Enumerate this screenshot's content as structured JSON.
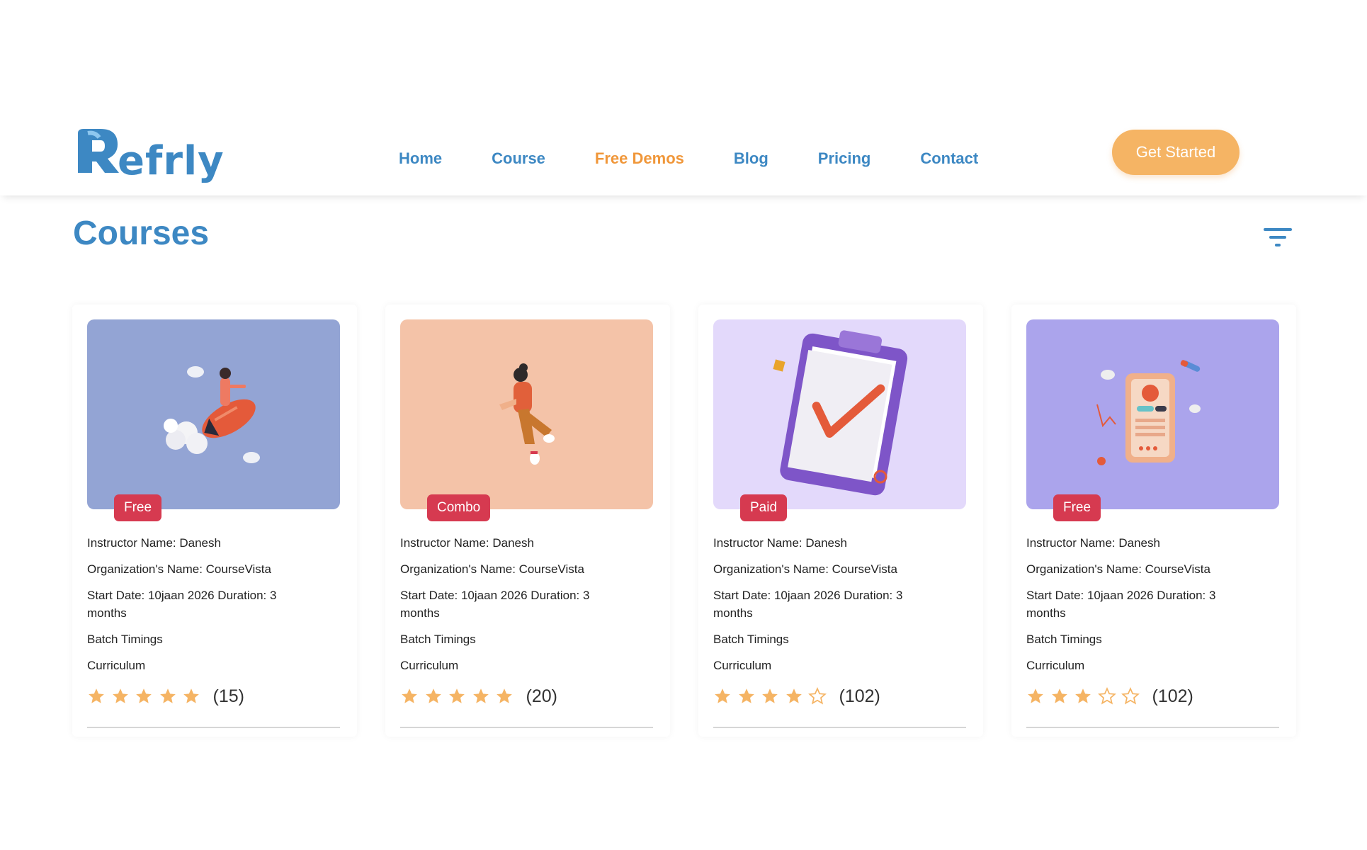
{
  "brand": {
    "name": "Refrly",
    "primary_color": "#3d88c3",
    "accent_color": "#f0973a"
  },
  "nav": {
    "items": [
      {
        "label": "Home",
        "active": false
      },
      {
        "label": "Course",
        "active": false
      },
      {
        "label": "Free Demos",
        "active": true
      },
      {
        "label": "Blog",
        "active": false
      },
      {
        "label": "Pricing",
        "active": false
      },
      {
        "label": "Contact",
        "active": false
      }
    ],
    "cta_label": "Get Started"
  },
  "page": {
    "title": "Courses",
    "filter_icon": "filter-icon"
  },
  "cards": [
    {
      "badge": "Free",
      "thumb_color": "#93a4d4",
      "instructor": "Instructor Name: Danesh",
      "organization": "Organization's Name: CourseVista",
      "start": "Start Date: 10jaan 2026 Duration: 3 months",
      "batch": "Batch Timings",
      "curriculum": "Curriculum",
      "rating": 5,
      "count": "(15)"
    },
    {
      "badge": "Combo",
      "thumb_color": "#f4c3a8",
      "instructor": "Instructor Name: Danesh",
      "organization": "Organization's Name: CourseVista",
      "start": "Start Date: 10jaan 2026 Duration: 3 months",
      "batch": "Batch Timings",
      "curriculum": "Curriculum",
      "rating": 5,
      "count": "(20)"
    },
    {
      "badge": "Paid",
      "thumb_color": "#e3d9fb",
      "instructor": "Instructor Name: Danesh",
      "organization": "Organization's Name: CourseVista",
      "start": "Start Date: 10jaan 2026 Duration: 3 months",
      "batch": "Batch Timings",
      "curriculum": "Curriculum",
      "rating": 4,
      "count": "(102)"
    },
    {
      "badge": "Free",
      "thumb_color": "#aba4ec",
      "instructor": "Instructor Name: Danesh",
      "organization": "Organization's Name: CourseVista",
      "start": "Start Date: 10jaan 2026 Duration: 3 months",
      "batch": "Batch Timings",
      "curriculum": "Curriculum",
      "rating": 3,
      "count": "(102)"
    }
  ]
}
